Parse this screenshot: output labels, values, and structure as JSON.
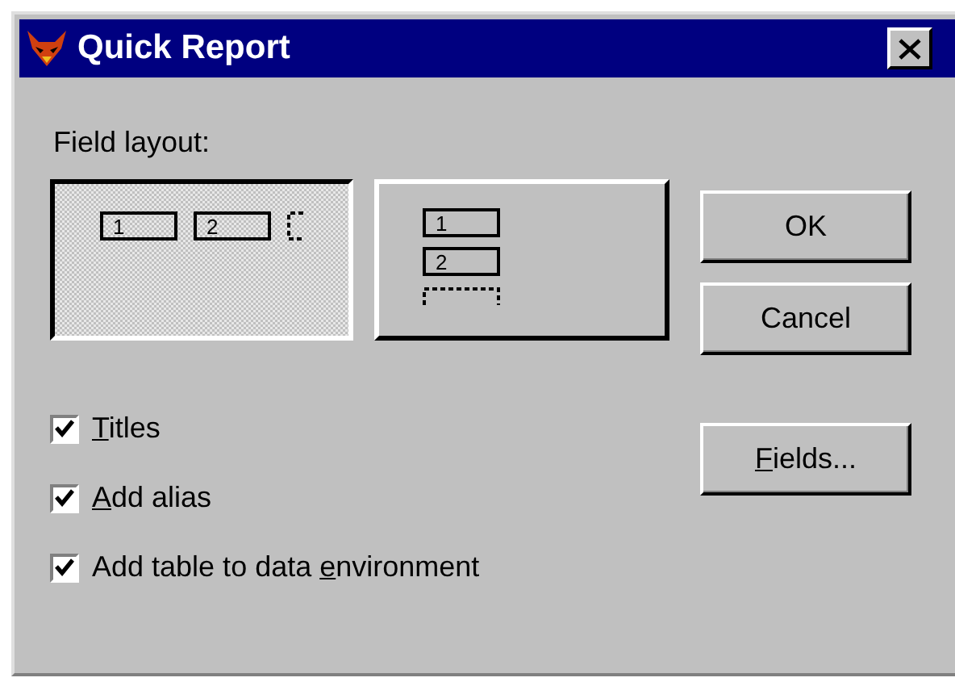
{
  "window": {
    "title": "Quick Report"
  },
  "field_layout": {
    "label": "Field layout:",
    "options": [
      {
        "kind": "columns",
        "selected": true,
        "fields": [
          "1",
          "2"
        ]
      },
      {
        "kind": "rows",
        "selected": false,
        "fields": [
          "1",
          "2"
        ]
      }
    ]
  },
  "buttons": [
    {
      "label": "OK"
    },
    {
      "label": "Cancel"
    }
  ],
  "fields_button": {
    "access_key": "F",
    "after": "ields..."
  },
  "checkboxes": [
    {
      "access_key": "T",
      "after": "itles",
      "checked": true
    },
    {
      "access_key": "A",
      "after": "dd alias",
      "checked": true
    },
    {
      "before": "Add table to data ",
      "access_key": "e",
      "after": "nvironment",
      "checked": true
    }
  ]
}
